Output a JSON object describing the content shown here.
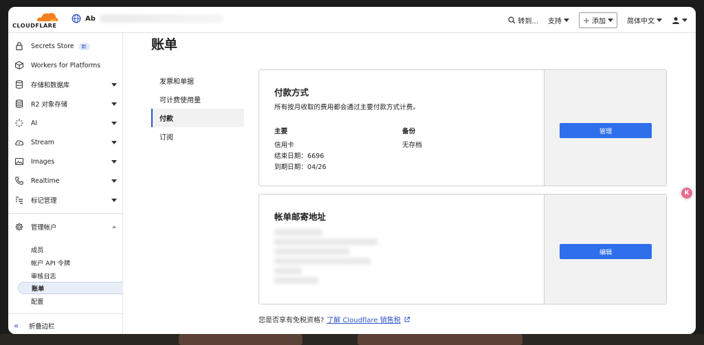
{
  "header": {
    "logo_text": "CLOUDFLARE",
    "account_name": "Ab",
    "goto_label": "转到...",
    "support_label": "支持",
    "add_label": "添加",
    "language_label": "简体中文"
  },
  "sidebar": {
    "items": [
      {
        "label": "Secrets Store",
        "badge": "新",
        "icon": "lock-icon"
      },
      {
        "label": "Workers for Platforms",
        "icon": "cube-icon"
      },
      {
        "label": "存储和数据库",
        "icon": "database-icon"
      },
      {
        "label": "R2 对象存储",
        "icon": "bucket-icon"
      },
      {
        "label": "AI",
        "icon": "sparkle-icon"
      },
      {
        "label": "Stream",
        "icon": "cloud-play-icon"
      },
      {
        "label": "Images",
        "icon": "image-icon"
      },
      {
        "label": "Realtime",
        "icon": "phone-icon"
      },
      {
        "label": "标记管理",
        "icon": "tag-list-icon"
      }
    ],
    "manage_account": {
      "label": "管理帐户",
      "icon": "gear-icon",
      "children": [
        "成员",
        "帐户 API 令牌",
        "审核日志",
        "账单",
        "配置"
      ]
    },
    "collapse_label": "折叠边栏"
  },
  "main": {
    "title": "账单",
    "subnav": [
      "发票和单据",
      "可计费使用量",
      "付款",
      "订阅"
    ],
    "payment": {
      "title": "付款方式",
      "description": "所有按月收取的费用都会通过主要付款方式计费。",
      "primary_heading": "主要",
      "primary_type": "信用卡",
      "end_date": "结束日期：6696",
      "expiry": "到期日期：04/26",
      "backup_heading": "备份",
      "backup_value": "无存档",
      "manage_button": "管理"
    },
    "address": {
      "title": "帐单邮寄地址",
      "edit_button": "编辑"
    },
    "footer": {
      "question": "您是否享有免税资格?",
      "link": "了解 Cloudflare 销售税"
    }
  },
  "floating_badge": "K"
}
